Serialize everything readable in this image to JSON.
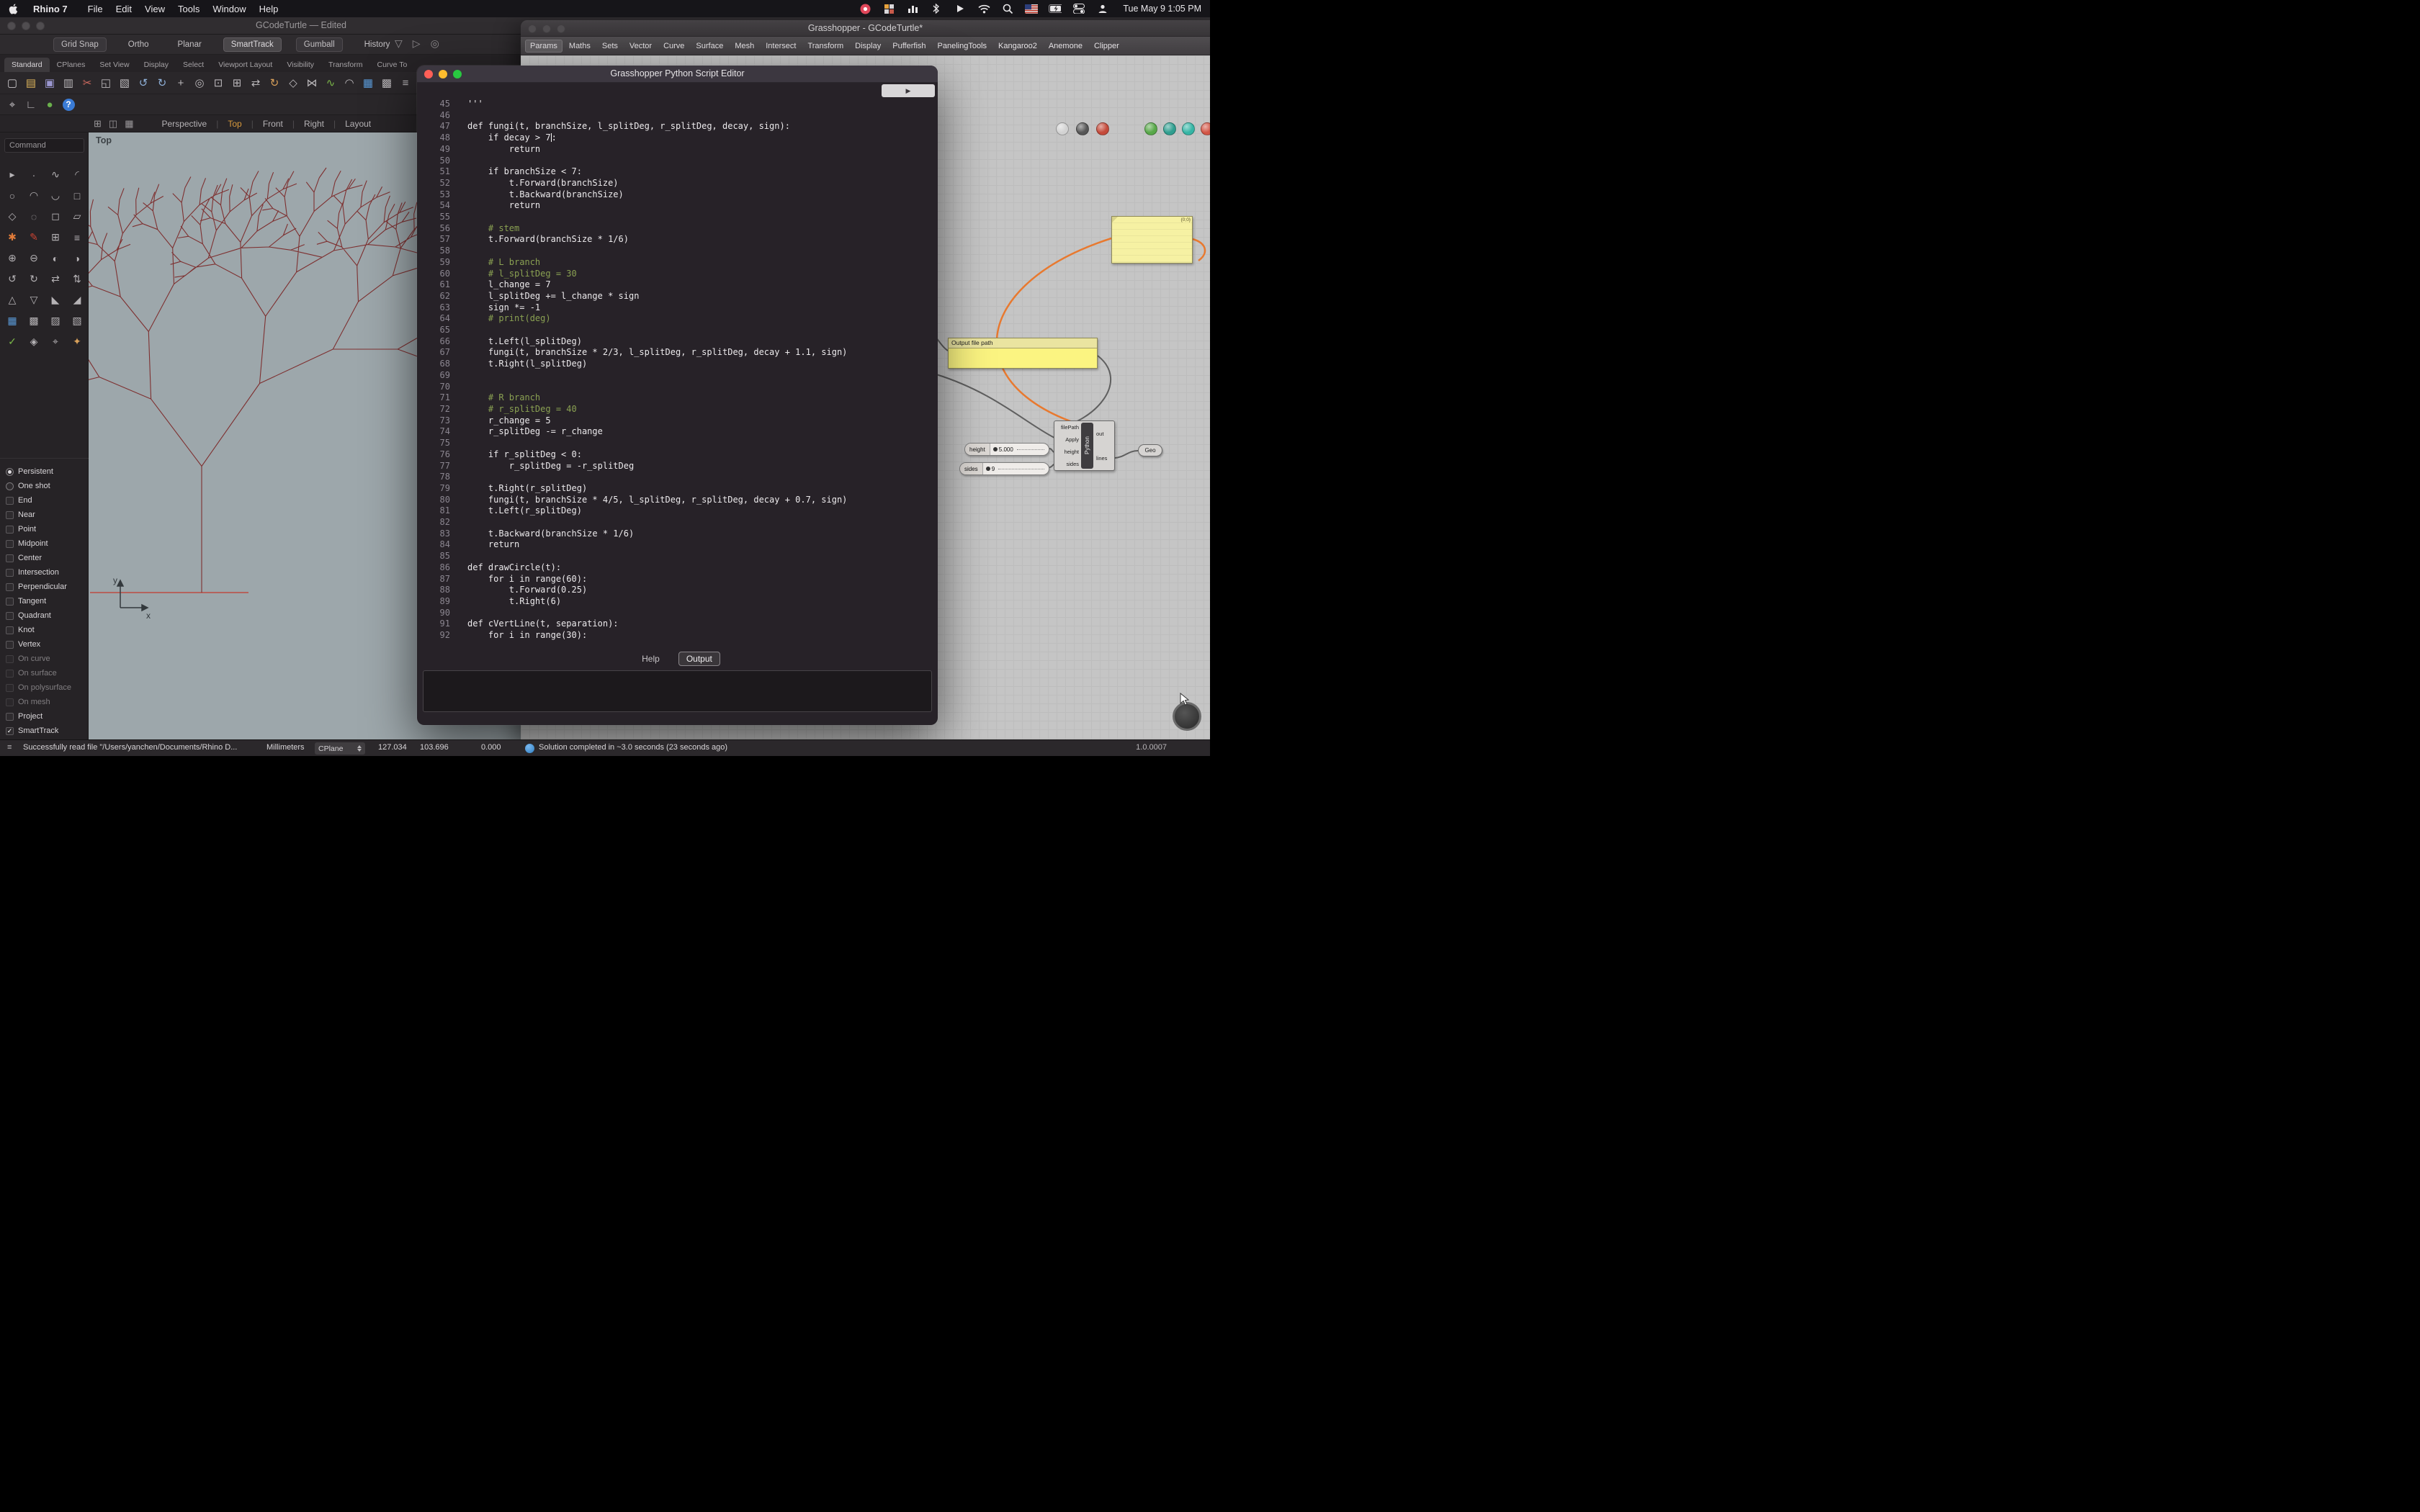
{
  "menu_bar": {
    "app": "Rhino 7",
    "menus": [
      "File",
      "Edit",
      "View",
      "Tools",
      "Window",
      "Help"
    ],
    "status_icons": [
      "record-icon",
      "grid-app-icon",
      "stats-icon",
      "bluetooth-icon",
      "airplay-icon",
      "wifi-icon",
      "spotlight-icon",
      "keyboard-flag-icon",
      "battery-icon",
      "control-center-icon",
      "user-icon"
    ],
    "clock": "Tue May 9 1:05 PM"
  },
  "rhino": {
    "title": "GCodeTurtle — Edited",
    "toggles": [
      {
        "label": "Grid Snap",
        "state": "boxed"
      },
      {
        "label": "Ortho",
        "state": "plain"
      },
      {
        "label": "Planar",
        "state": "plain"
      },
      {
        "label": "SmartTrack",
        "state": "filled"
      },
      {
        "label": "Gumball",
        "state": "boxed"
      },
      {
        "label": "History",
        "state": "plain"
      }
    ],
    "row1_icons": [
      {
        "name": "selection-filter-icon",
        "glyph": "▽",
        "color": "#8f8c8f"
      },
      {
        "name": "history-play-icon",
        "glyph": "▷",
        "color": "#8f8c8f"
      },
      {
        "name": "record-history-icon",
        "glyph": "◎",
        "color": "#8f8c8f"
      }
    ],
    "tabs": [
      "Standard",
      "CPlanes",
      "Set View",
      "Display",
      "Select",
      "Viewport Layout",
      "Visibility",
      "Transform",
      "Curve To"
    ],
    "active_tab": "Standard",
    "main_icons": [
      {
        "name": "new-file-icon",
        "glyph": "▢",
        "color": "#c9c6c9"
      },
      {
        "name": "open-file-icon",
        "glyph": "▤",
        "color": "#d8b05a"
      },
      {
        "name": "save-icon",
        "glyph": "▣",
        "color": "#9a96cf"
      },
      {
        "name": "print-icon",
        "glyph": "▥",
        "color": "#b9b6b9"
      },
      {
        "name": "cut-icon",
        "glyph": "✂",
        "color": "#cf6a5f"
      },
      {
        "name": "copy-icon",
        "glyph": "◱",
        "color": "#b9b6b9"
      },
      {
        "name": "paste-icon",
        "glyph": "▧",
        "color": "#b9b6b9"
      },
      {
        "name": "undo-icon",
        "glyph": "↺",
        "color": "#8fb0d8"
      },
      {
        "name": "redo-icon",
        "glyph": "↻",
        "color": "#8fb0d8"
      },
      {
        "name": "pan-icon",
        "glyph": "+",
        "color": "#b9b6b9"
      },
      {
        "name": "zoom-icon",
        "glyph": "◎",
        "color": "#b9b6b9"
      },
      {
        "name": "zoom-window-icon",
        "glyph": "⊡",
        "color": "#b9b6b9"
      },
      {
        "name": "zoom-extents-icon",
        "glyph": "⊞",
        "color": "#b9b6b9"
      },
      {
        "name": "move-icon",
        "glyph": "⇄",
        "color": "#b9b6b9"
      },
      {
        "name": "rotate-icon",
        "glyph": "↻",
        "color": "#d8a05a"
      },
      {
        "name": "scale-icon",
        "glyph": "◇",
        "color": "#b9b6b9"
      },
      {
        "name": "mirror-icon",
        "glyph": "⋈",
        "color": "#b9b6b9"
      },
      {
        "name": "curve-icon",
        "glyph": "∿",
        "color": "#7ab648"
      },
      {
        "name": "arc-icon",
        "glyph": "◠",
        "color": "#b9b6b9"
      },
      {
        "name": "surface-icon",
        "glyph": "▦",
        "color": "#5a9ad8"
      },
      {
        "name": "mesh-icon",
        "glyph": "▩",
        "color": "#b9b6b9"
      },
      {
        "name": "layers-icon",
        "glyph": "≡",
        "color": "#b9b6b9"
      }
    ],
    "secondary_icons": [
      {
        "name": "mouse-select-icon",
        "glyph": "⌖",
        "color": "#c8c5c8"
      },
      {
        "name": "cplane-axes-icon",
        "glyph": "∟",
        "color": "#b9b6b9"
      },
      {
        "name": "gumball-icon",
        "glyph": "●",
        "color": "#6ab04c"
      },
      {
        "name": "help-icon",
        "glyph": "?",
        "color": "#ffffff",
        "bg": "#3a7bd5"
      }
    ],
    "viewport_mini_icons": [
      {
        "name": "grid-toggle-icon",
        "glyph": "⊞"
      },
      {
        "name": "split-view-icon",
        "glyph": "◫"
      },
      {
        "name": "layout-grid-icon",
        "glyph": "▦"
      }
    ],
    "viewport_tabs": [
      "Perspective",
      "Top",
      "Front",
      "Right",
      "Layout"
    ],
    "active_viewport_tab": "Top",
    "viewport_label": "Top",
    "command_label": "Command",
    "axis": {
      "x": "x",
      "y": "y"
    },
    "sidebar_icons": [
      {
        "name": "pointer-icon",
        "glyph": "▸"
      },
      {
        "name": "point-icon",
        "glyph": "·"
      },
      {
        "name": "freeform-curve-icon",
        "glyph": "∿"
      },
      {
        "name": "arc-curve-icon",
        "glyph": "◜"
      },
      {
        "name": "circle-icon",
        "glyph": "○"
      },
      {
        "name": "arc-icon",
        "glyph": "◠"
      },
      {
        "name": "arc-down-icon",
        "glyph": "◡"
      },
      {
        "name": "rectangle-icon",
        "glyph": "□"
      },
      {
        "name": "polygon-icon",
        "glyph": "◇"
      },
      {
        "name": "ellipse-icon",
        "glyph": "◌"
      },
      {
        "name": "plane-icon",
        "glyph": "◻"
      },
      {
        "name": "parallelogram-icon",
        "glyph": "▱"
      },
      {
        "name": "star-icon",
        "glyph": "✱",
        "color": "#e07b39"
      },
      {
        "name": "pencil-icon",
        "glyph": "✎",
        "color": "#cc4433"
      },
      {
        "name": "grid-cell-icon",
        "glyph": "⊞"
      },
      {
        "name": "list-icon",
        "glyph": "≡"
      },
      {
        "name": "boolean-union-icon",
        "glyph": "⊕"
      },
      {
        "name": "boolean-diff-icon",
        "glyph": "⊖"
      },
      {
        "name": "shade-left-icon",
        "glyph": "◐"
      },
      {
        "name": "shade-right-icon",
        "glyph": "◑"
      },
      {
        "name": "undo-view-icon",
        "glyph": "↺"
      },
      {
        "name": "redo-view-icon",
        "glyph": "↻"
      },
      {
        "name": "swap-h-icon",
        "glyph": "⇄"
      },
      {
        "name": "swap-v-icon",
        "glyph": "⇅"
      },
      {
        "name": "triangle-up-icon",
        "glyph": "△"
      },
      {
        "name": "triangle-down-icon",
        "glyph": "▽"
      },
      {
        "name": "corner-bl-icon",
        "glyph": "◣"
      },
      {
        "name": "corner-br-icon",
        "glyph": "◢"
      },
      {
        "name": "mesh-grid-icon",
        "glyph": "▦",
        "color": "#5a9ad8"
      },
      {
        "name": "hatch-dense-icon",
        "glyph": "▩"
      },
      {
        "name": "hatch-left-icon",
        "glyph": "▨"
      },
      {
        "name": "hatch-right-icon",
        "glyph": "▧"
      },
      {
        "name": "check-icon",
        "glyph": "✓",
        "color": "#7ab648"
      },
      {
        "name": "gem-icon",
        "glyph": "◈"
      },
      {
        "name": "target-icon",
        "glyph": "⌖"
      },
      {
        "name": "sparkle-icon",
        "glyph": "✦",
        "color": "#d8a05a"
      }
    ],
    "osnap_items": [
      {
        "label": "Persistent",
        "kind": "radio",
        "checked": true
      },
      {
        "label": "One shot",
        "kind": "radio",
        "checked": false
      },
      {
        "label": "End",
        "kind": "check",
        "checked": false
      },
      {
        "label": "Near",
        "kind": "check",
        "checked": false
      },
      {
        "label": "Point",
        "kind": "check",
        "checked": false
      },
      {
        "label": "Midpoint",
        "kind": "check",
        "checked": false
      },
      {
        "label": "Center",
        "kind": "check",
        "checked": false
      },
      {
        "label": "Intersection",
        "kind": "check",
        "checked": false
      },
      {
        "label": "Perpendicular",
        "kind": "check",
        "checked": false
      },
      {
        "label": "Tangent",
        "kind": "check",
        "checked": false
      },
      {
        "label": "Quadrant",
        "kind": "check",
        "checked": false
      },
      {
        "label": "Knot",
        "kind": "check",
        "checked": false
      },
      {
        "label": "Vertex",
        "kind": "check",
        "checked": false
      },
      {
        "label": "On curve",
        "kind": "check",
        "checked": false,
        "dim": true
      },
      {
        "label": "On surface",
        "kind": "check",
        "checked": false,
        "dim": true
      },
      {
        "label": "On polysurface",
        "kind": "check",
        "checked": false,
        "dim": true
      },
      {
        "label": "On mesh",
        "kind": "check",
        "checked": false,
        "dim": true
      },
      {
        "label": "Project",
        "kind": "check",
        "checked": false
      },
      {
        "label": "SmartTrack",
        "kind": "check",
        "checked": true
      }
    ],
    "tree_color": "#7e3030",
    "axis_line_color": "#c23b2e"
  },
  "grasshopper": {
    "title": "Grasshopper - GCodeTurtle*",
    "menus": [
      "Params",
      "Maths",
      "Sets",
      "Vector",
      "Curve",
      "Surface",
      "Mesh",
      "Intersect",
      "Transform",
      "Display",
      "Pufferfish",
      "PanelingTools",
      "Kangaroo2",
      "Anemone",
      "Clipper"
    ],
    "active_menu": "Params",
    "display_balls": [
      {
        "name": "display-wireframe-icon",
        "color": "#d2d2d2"
      },
      {
        "name": "display-shaded-icon",
        "color": "#565656"
      },
      {
        "name": "display-rendered-icon",
        "color": "#c44a3a"
      },
      {
        "name": "display-green-icon",
        "color": "#58a849"
      },
      {
        "name": "display-teal-icon",
        "color": "#2f9e8f"
      },
      {
        "name": "display-aqua-icon",
        "color": "#35b5a5"
      },
      {
        "name": "display-red-icon",
        "color": "#d25545"
      }
    ],
    "panel_tag": "{0;0}",
    "output_panel": {
      "title": "Output file path"
    },
    "python": {
      "label": "Python",
      "inputs": [
        "filePath",
        "Apply",
        "height",
        "sides"
      ],
      "outputs": [
        "out",
        "lines"
      ]
    },
    "geo_label": "Geo",
    "sliders": [
      {
        "name": "height",
        "value": "5.000"
      },
      {
        "name": "sides",
        "value": "9"
      }
    ],
    "wire_color": "#5f5f5f",
    "selected_wire_color": "#e8792f"
  },
  "editor": {
    "title": "Grasshopper Python Script Editor",
    "run_glyph": "▶",
    "tabs": [
      "Help",
      "Output"
    ],
    "active_tab": "Output",
    "cursor": {
      "line": 48,
      "col": 16
    },
    "lines": [
      {
        "n": 45,
        "t": "'''"
      },
      {
        "n": 46,
        "t": ""
      },
      {
        "n": 47,
        "t": "def fungi(t, branchSize, l_splitDeg, r_splitDeg, decay, sign):"
      },
      {
        "n": 48,
        "t": "    if decay > 7:"
      },
      {
        "n": 49,
        "t": "        return"
      },
      {
        "n": 50,
        "t": ""
      },
      {
        "n": 51,
        "t": "    if branchSize < 7:"
      },
      {
        "n": 52,
        "t": "        t.Forward(branchSize)"
      },
      {
        "n": 53,
        "t": "        t.Backward(branchSize)"
      },
      {
        "n": 54,
        "t": "        return"
      },
      {
        "n": 55,
        "t": ""
      },
      {
        "n": 56,
        "t": "    # stem"
      },
      {
        "n": 57,
        "t": "    t.Forward(branchSize * 1/6)"
      },
      {
        "n": 58,
        "t": ""
      },
      {
        "n": 59,
        "t": "    # L branch"
      },
      {
        "n": 60,
        "t": "    # l_splitDeg = 30"
      },
      {
        "n": 61,
        "t": "    l_change = 7"
      },
      {
        "n": 62,
        "t": "    l_splitDeg += l_change * sign"
      },
      {
        "n": 63,
        "t": "    sign *= -1"
      },
      {
        "n": 64,
        "t": "    # print(deg)"
      },
      {
        "n": 65,
        "t": ""
      },
      {
        "n": 66,
        "t": "    t.Left(l_splitDeg)"
      },
      {
        "n": 67,
        "t": "    fungi(t, branchSize * 2/3, l_splitDeg, r_splitDeg, decay + 1.1, sign)"
      },
      {
        "n": 68,
        "t": "    t.Right(l_splitDeg)"
      },
      {
        "n": 69,
        "t": ""
      },
      {
        "n": 70,
        "t": ""
      },
      {
        "n": 71,
        "t": "    # R branch"
      },
      {
        "n": 72,
        "t": "    # r_splitDeg = 40"
      },
      {
        "n": 73,
        "t": "    r_change = 5"
      },
      {
        "n": 74,
        "t": "    r_splitDeg -= r_change"
      },
      {
        "n": 75,
        "t": ""
      },
      {
        "n": 76,
        "t": "    if r_splitDeg < 0:"
      },
      {
        "n": 77,
        "t": "        r_splitDeg = -r_splitDeg"
      },
      {
        "n": 78,
        "t": ""
      },
      {
        "n": 79,
        "t": "    t.Right(r_splitDeg)"
      },
      {
        "n": 80,
        "t": "    fungi(t, branchSize * 4/5, l_splitDeg, r_splitDeg, decay + 0.7, sign)"
      },
      {
        "n": 81,
        "t": "    t.Left(r_splitDeg)"
      },
      {
        "n": 82,
        "t": ""
      },
      {
        "n": 83,
        "t": "    t.Backward(branchSize * 1/6)"
      },
      {
        "n": 84,
        "t": "    return"
      },
      {
        "n": 85,
        "t": ""
      },
      {
        "n": 86,
        "t": "def drawCircle(t):"
      },
      {
        "n": 87,
        "t": "    for i in range(60):"
      },
      {
        "n": 88,
        "t": "        t.Forward(0.25)"
      },
      {
        "n": 89,
        "t": "        t.Right(6)"
      },
      {
        "n": 90,
        "t": ""
      },
      {
        "n": 91,
        "t": "def cVertLine(t, separation):"
      },
      {
        "n": 92,
        "t": "    for i in range(30):"
      }
    ]
  },
  "status_bar": {
    "message": "Successfully read file \"/Users/yanchen/Documents/Rhino D...",
    "units": "Millimeters",
    "cplane": "CPlane",
    "coords": [
      "127.034",
      "103.696",
      "0.000"
    ],
    "gh_status": "Solution completed in ~3.0 seconds (23 seconds ago)",
    "version": "1.0.0007"
  }
}
